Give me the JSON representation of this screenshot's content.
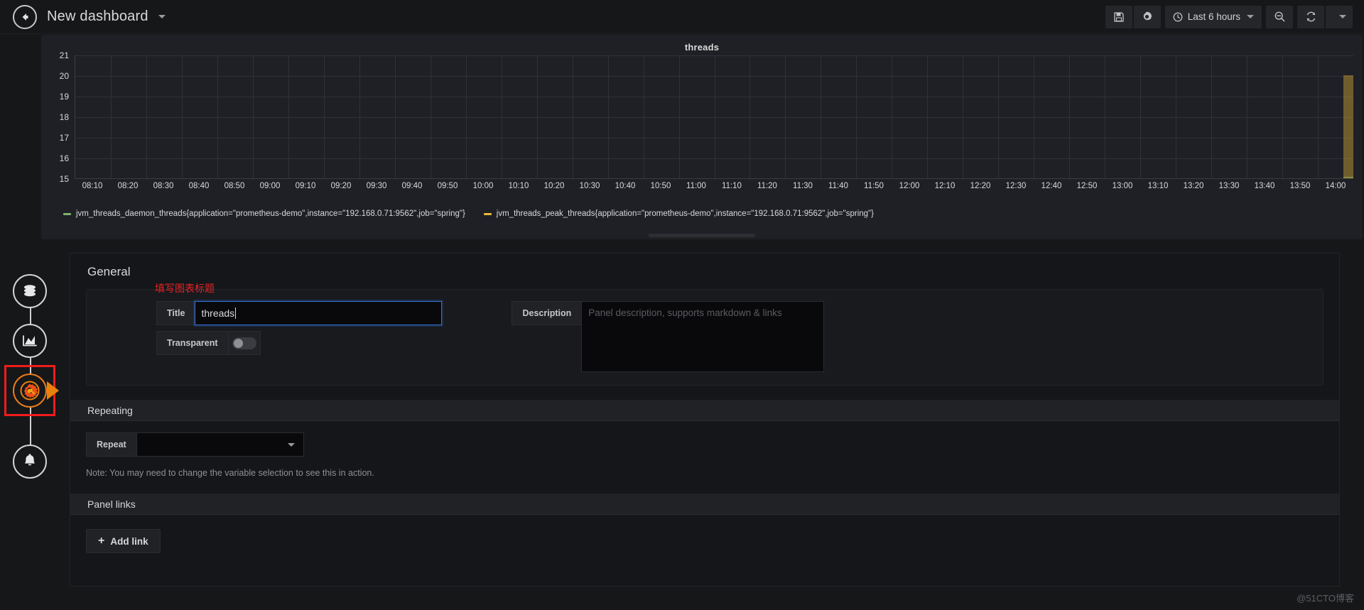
{
  "topnav": {
    "back_icon": "back-arrow-icon",
    "dashboard_title": "New dashboard",
    "save_icon": "save-floppy-icon",
    "settings_icon": "gear-icon",
    "time_clock_icon": "clock-icon",
    "time_range": "Last 6 hours",
    "zoom_out_icon": "zoom-out-magnifier-icon",
    "refresh_icon": "refresh-icon",
    "refresh_caret_icon": "chevron-down-icon"
  },
  "graph_panel": {
    "title": "threads",
    "resize_handle": "panel-resize-handle"
  },
  "chart_data": {
    "type": "area",
    "title": "threads",
    "xlabel": "",
    "ylabel": "",
    "ylim": [
      15,
      21
    ],
    "yticks": [
      21,
      20,
      19,
      18,
      17,
      16,
      15
    ],
    "grid": true,
    "legend_position": "bottom",
    "xticks": [
      "08:10",
      "08:20",
      "08:30",
      "08:40",
      "08:50",
      "09:00",
      "09:10",
      "09:20",
      "09:30",
      "09:40",
      "09:50",
      "10:00",
      "10:10",
      "10:20",
      "10:30",
      "10:40",
      "10:50",
      "11:00",
      "11:10",
      "11:20",
      "11:30",
      "11:40",
      "11:50",
      "12:00",
      "12:10",
      "12:20",
      "12:30",
      "12:40",
      "12:50",
      "13:00",
      "13:10",
      "13:20",
      "13:30",
      "13:40",
      "13:50",
      "14:00"
    ],
    "series": [
      {
        "name": "jvm_threads_daemon_threads{application=\"prometheus-demo\",instance=\"192.168.0.71:9562\",job=\"spring\"}",
        "color": "#7eb26d",
        "last_value": 15,
        "note": "only data at far right edge of window"
      },
      {
        "name": "jvm_threads_peak_threads{application=\"prometheus-demo\",instance=\"192.168.0.71:9562\",job=\"spring\"}",
        "color": "#eab839",
        "last_value": 20,
        "note": "only data at far right edge of window"
      }
    ]
  },
  "edit_rail": {
    "items": [
      {
        "name": "datasource-icon",
        "label": "Queries"
      },
      {
        "name": "graph-visualization-icon",
        "label": "Visualization"
      },
      {
        "name": "general-settings-icon",
        "label": "General"
      },
      {
        "name": "alert-bell-icon",
        "label": "Alert"
      }
    ],
    "active_index": 2,
    "highlight_color": "#f01c1c",
    "active_color": "#eb7b18"
  },
  "general": {
    "heading": "General",
    "annotation": "填写图表标题",
    "annotation_color": "#ec2121",
    "title_label": "Title",
    "title_value": "threads",
    "transparent_label": "Transparent",
    "transparent_on": false,
    "description_label": "Description",
    "description_value": "",
    "description_placeholder": "Panel description, supports markdown & links"
  },
  "repeating": {
    "heading": "Repeating",
    "repeat_label": "Repeat",
    "repeat_value": "",
    "repeat_caret_icon": "chevron-down-icon",
    "note": "Note: You may need to change the variable selection to see this in action."
  },
  "panel_links": {
    "heading": "Panel links",
    "add_link_label": "Add link",
    "add_link_icon": "plus-icon"
  },
  "watermark": "@51CTO博客"
}
